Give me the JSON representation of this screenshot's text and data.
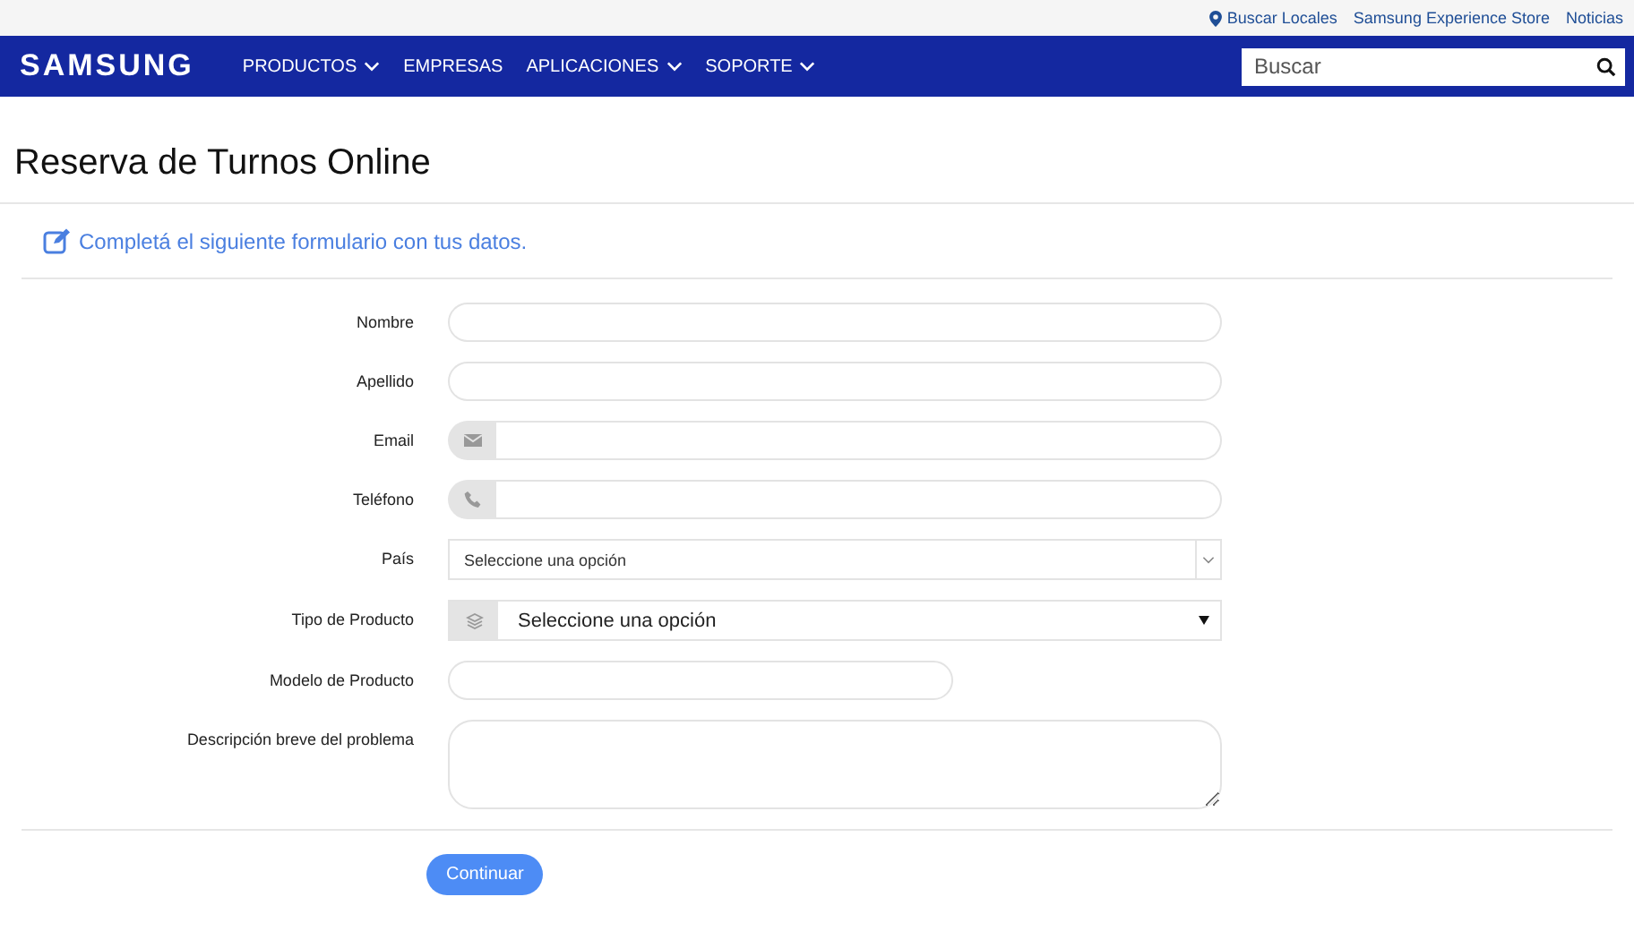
{
  "utility_links": [
    {
      "label": "Buscar Locales",
      "kind": "location"
    },
    {
      "label": "Samsung Experience Store",
      "kind": "plain"
    },
    {
      "label": "Noticias",
      "kind": "plain"
    }
  ],
  "logo": "SAMSUNG",
  "nav": [
    {
      "label": "PRODUCTOS",
      "dropdown": true
    },
    {
      "label": "EMPRESAS",
      "dropdown": false
    },
    {
      "label": "APLICACIONES",
      "dropdown": true
    },
    {
      "label": "SOPORTE",
      "dropdown": true
    }
  ],
  "search": {
    "placeholder": "Buscar"
  },
  "page_title": "Reserva de Turnos Online",
  "form_intro": "Completá el siguiente formulario con tus datos.",
  "fields": [
    {
      "label": "Nombre",
      "kind": "text"
    },
    {
      "label": "Apellido",
      "kind": "text"
    },
    {
      "label": "Email",
      "kind": "email"
    },
    {
      "label": "Teléfono",
      "kind": "phone"
    },
    {
      "label": "País",
      "kind": "select",
      "value": "Seleccione una opción"
    },
    {
      "label": "Tipo de Producto",
      "kind": "select-icon",
      "value": "Seleccione una opción"
    },
    {
      "label": "Modelo de Producto",
      "kind": "short"
    },
    {
      "label": "Descripción breve del problema",
      "kind": "textarea"
    }
  ],
  "submit": "Continuar"
}
